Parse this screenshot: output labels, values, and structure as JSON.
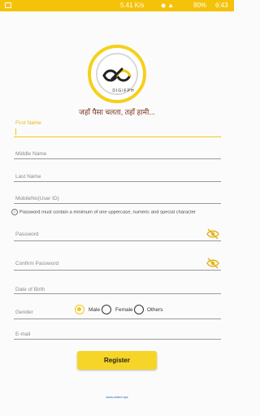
{
  "status": {
    "speed": "5.41 K/s",
    "battery": "80%",
    "time": "6:43"
  },
  "brand": {
    "name": "DIGIFPH",
    "tagline": "जहाँ पैसा चलता, तहाँ हामी..."
  },
  "form": {
    "first_name": "First Name",
    "middle_name": "Middle Name",
    "last_name": "Last Name",
    "mobile": "MobileNo(User ID)",
    "password_note": "Password must contain a minimum of one uppercase, numeric and special character",
    "password": "Password",
    "confirm_password": "Confirm Password",
    "dob": "Date of Birth",
    "gender_label": "Gender",
    "gender_options": [
      "Male",
      "Female",
      "Others"
    ],
    "gender_selected": "Male",
    "email": "E-mail"
  },
  "register_label": "Register",
  "footer": "www.clotmr.sys",
  "colors": {
    "accent": "#f5c20a",
    "button": "#f7d528"
  }
}
